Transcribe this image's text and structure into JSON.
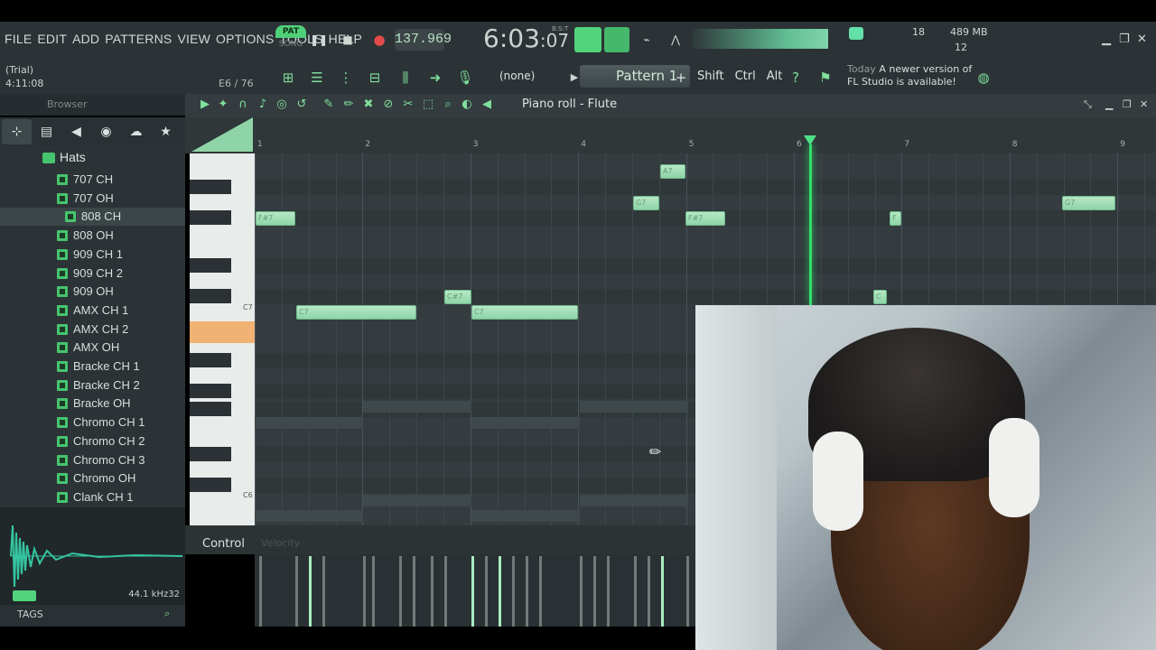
{
  "menu": [
    "FILE",
    "EDIT",
    "ADD",
    "PATTERNS",
    "VIEW",
    "OPTIONS",
    "TOOLS",
    "HELP"
  ],
  "transport": {
    "pat_label": "PAT",
    "song_label": "SONG",
    "tempo": "137.969",
    "time_main": "6:03",
    "time_sub": ":07",
    "time_unit": "B:S:T"
  },
  "stats": {
    "cpu": "18",
    "mem": "489 MB",
    "poly": "12"
  },
  "trial": {
    "line1": "(Trial)",
    "line2": "4:11:08"
  },
  "position_label": "E6 / 76",
  "pattern_selector": {
    "none_label": "(none)",
    "pattern_label": "Pattern 1",
    "add": "+"
  },
  "mod_keys": [
    "Shift",
    "Ctrl",
    "Alt"
  ],
  "news": {
    "today": "Today",
    "line1": "A newer version of",
    "line2": "FL Studio is available!"
  },
  "browser": {
    "title": "Browser",
    "folder": "Hats",
    "items": [
      "707 CH",
      "707 OH",
      "808 CH",
      "808 OH",
      "909 CH 1",
      "909 CH 2",
      "909 OH",
      "AMX CH 1",
      "AMX CH 2",
      "AMX OH",
      "Bracke CH 1",
      "Bracke CH 2",
      "Bracke OH",
      "Chromo CH 1",
      "Chromo CH 2",
      "Chromo CH 3",
      "Chromo OH",
      "Clank CH 1"
    ],
    "selected": "808 CH",
    "sample_rate": "44.1 kHz32",
    "tags": "TAGS"
  },
  "piano_roll": {
    "title": "Piano roll - Flute",
    "bar_numbers": [
      "1",
      "2",
      "3",
      "4",
      "5",
      "6",
      "7",
      "8",
      "9"
    ],
    "key_labels": [
      "C7",
      "C6"
    ],
    "notes": [
      {
        "label": "A7"
      },
      {
        "label": "G7"
      },
      {
        "label": "F#7"
      },
      {
        "label": "F#7"
      },
      {
        "label": "F"
      },
      {
        "label": "G7"
      },
      {
        "label": "C#7"
      },
      {
        "label": "C7"
      },
      {
        "label": "C7"
      },
      {
        "label": "C"
      }
    ],
    "control_label": "Control",
    "velocity_label": "Velocity"
  }
}
